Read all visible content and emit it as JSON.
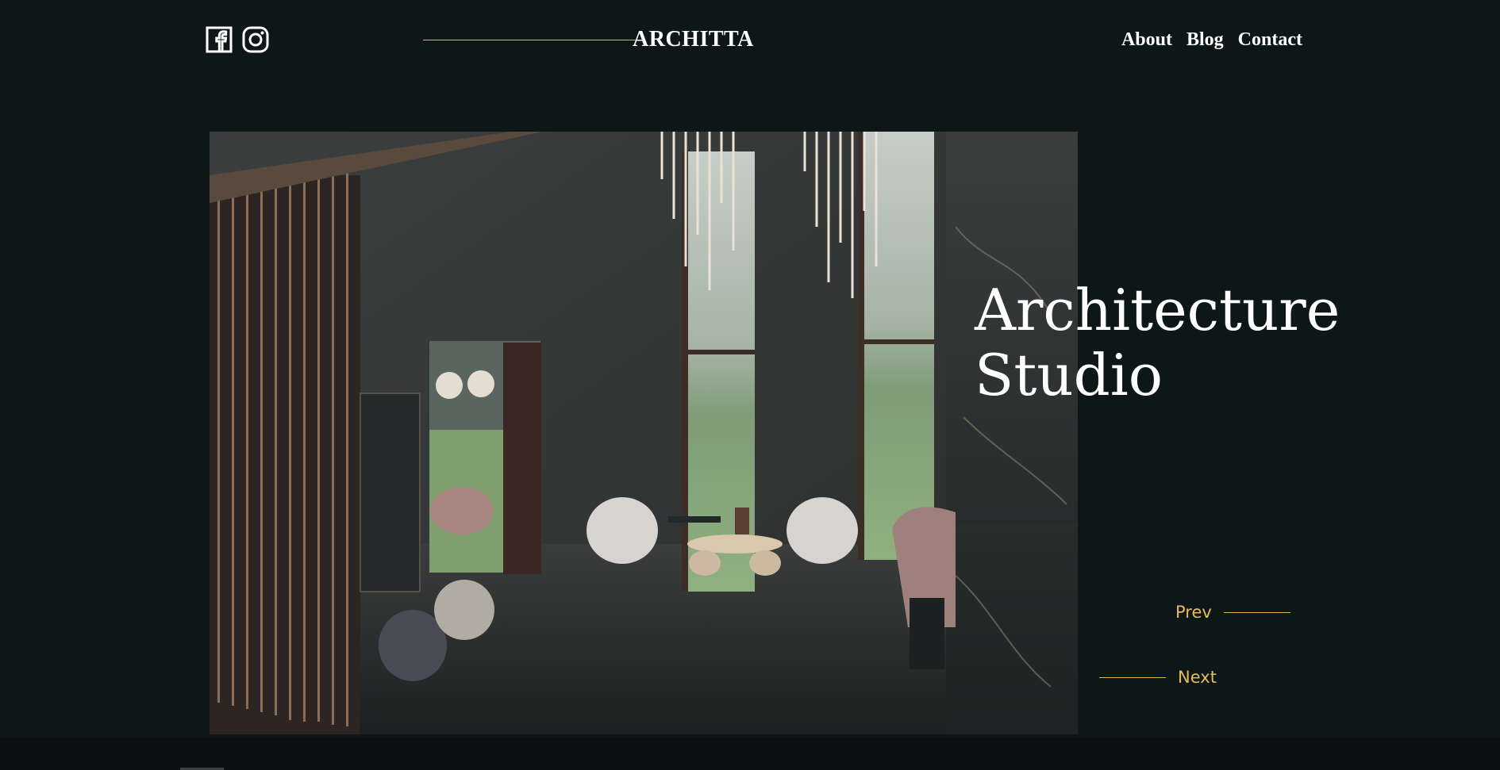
{
  "header": {
    "logo": "ARCHITTA",
    "social": [
      {
        "icon": "facebook-icon"
      },
      {
        "icon": "instagram-icon"
      }
    ],
    "nav": [
      {
        "label": "About"
      },
      {
        "label": "Blog"
      },
      {
        "label": "Contact"
      }
    ]
  },
  "hero": {
    "title_line1": "Architecture",
    "title_line2": "Studio",
    "image_subject": "interior-photo"
  },
  "pager": {
    "prev_label": "Prev",
    "next_label": "Next"
  },
  "colors": {
    "background": "#0e1717",
    "accent": "#e8b95b",
    "text": "#ffffff",
    "logo_line": "#c8b489"
  }
}
